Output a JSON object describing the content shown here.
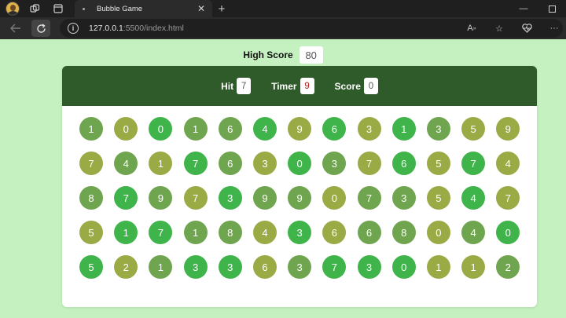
{
  "browser": {
    "tab_title": "Bubble Game",
    "new_tab_glyph": "+",
    "url_host": "127.0.0.1",
    "url_rest": ":5500/index.html"
  },
  "game": {
    "high_score_label": "High Score",
    "high_score": "80",
    "hit_label": "Hit",
    "hit": "7",
    "timer_label": "Timer",
    "timer": "9",
    "score_label": "Score",
    "score": "0"
  },
  "colors": {
    "panel_top": "#2f5b2a",
    "page_bg": "#c5f0bf",
    "bubble_bright": "#3fb44a",
    "bubble_mid": "#6fa54f",
    "bubble_olive": "#9aab45",
    "timer_text": "#b0201c"
  },
  "bubbles": [
    {
      "n": "1",
      "c": "mid"
    },
    {
      "n": "0",
      "c": "olive"
    },
    {
      "n": "0",
      "c": "bright"
    },
    {
      "n": "1",
      "c": "mid"
    },
    {
      "n": "6",
      "c": "mid"
    },
    {
      "n": "4",
      "c": "bright"
    },
    {
      "n": "9",
      "c": "olive"
    },
    {
      "n": "6",
      "c": "bright"
    },
    {
      "n": "3",
      "c": "olive"
    },
    {
      "n": "1",
      "c": "bright"
    },
    {
      "n": "3",
      "c": "mid"
    },
    {
      "n": "5",
      "c": "olive"
    },
    {
      "n": "9",
      "c": "olive"
    },
    {
      "n": "7",
      "c": "olive"
    },
    {
      "n": "4",
      "c": "mid"
    },
    {
      "n": "1",
      "c": "olive"
    },
    {
      "n": "7",
      "c": "bright"
    },
    {
      "n": "6",
      "c": "mid"
    },
    {
      "n": "3",
      "c": "olive"
    },
    {
      "n": "0",
      "c": "bright"
    },
    {
      "n": "3",
      "c": "mid"
    },
    {
      "n": "7",
      "c": "olive"
    },
    {
      "n": "6",
      "c": "bright"
    },
    {
      "n": "5",
      "c": "olive"
    },
    {
      "n": "7",
      "c": "bright"
    },
    {
      "n": "4",
      "c": "olive"
    },
    {
      "n": "8",
      "c": "mid"
    },
    {
      "n": "7",
      "c": "bright"
    },
    {
      "n": "9",
      "c": "mid"
    },
    {
      "n": "7",
      "c": "olive"
    },
    {
      "n": "3",
      "c": "bright"
    },
    {
      "n": "9",
      "c": "mid"
    },
    {
      "n": "9",
      "c": "mid"
    },
    {
      "n": "0",
      "c": "olive"
    },
    {
      "n": "7",
      "c": "mid"
    },
    {
      "n": "3",
      "c": "mid"
    },
    {
      "n": "5",
      "c": "olive"
    },
    {
      "n": "4",
      "c": "bright"
    },
    {
      "n": "7",
      "c": "olive"
    },
    {
      "n": "5",
      "c": "olive"
    },
    {
      "n": "1",
      "c": "bright"
    },
    {
      "n": "7",
      "c": "bright"
    },
    {
      "n": "1",
      "c": "mid"
    },
    {
      "n": "8",
      "c": "mid"
    },
    {
      "n": "4",
      "c": "olive"
    },
    {
      "n": "3",
      "c": "bright"
    },
    {
      "n": "6",
      "c": "olive"
    },
    {
      "n": "6",
      "c": "mid"
    },
    {
      "n": "8",
      "c": "mid"
    },
    {
      "n": "0",
      "c": "olive"
    },
    {
      "n": "4",
      "c": "mid"
    },
    {
      "n": "0",
      "c": "bright"
    },
    {
      "n": "5",
      "c": "bright"
    },
    {
      "n": "2",
      "c": "olive"
    },
    {
      "n": "1",
      "c": "mid"
    },
    {
      "n": "3",
      "c": "bright"
    },
    {
      "n": "3",
      "c": "bright"
    },
    {
      "n": "6",
      "c": "olive"
    },
    {
      "n": "3",
      "c": "mid"
    },
    {
      "n": "7",
      "c": "bright"
    },
    {
      "n": "3",
      "c": "bright"
    },
    {
      "n": "0",
      "c": "bright"
    },
    {
      "n": "1",
      "c": "olive"
    },
    {
      "n": "1",
      "c": "olive"
    },
    {
      "n": "2",
      "c": "mid"
    }
  ]
}
